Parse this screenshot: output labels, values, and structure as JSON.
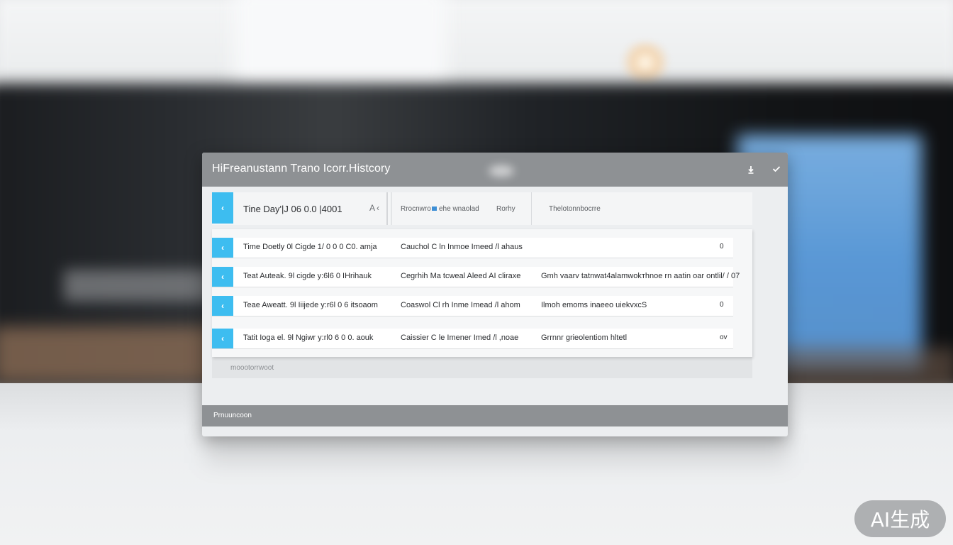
{
  "window": {
    "title": "HiFreanustann Trano Icorr.Histcory",
    "download_icon": "download-icon",
    "collapse_icon": "collapse-icon"
  },
  "header": {
    "accent_icon": "chevron-left-icon",
    "field_label": "Tine Day'|J 06 0.0 |4001",
    "tail_text": "А",
    "back_icon": "back-chevron-icon",
    "columns": [
      "Rrocnwro",
      "ehe wnaolad",
      "Rorhy",
      "Thelotonnbocrre"
    ]
  },
  "rows": [
    {
      "c1": "Time  Doetly  0l  Cigde  1/ 0 0 0 C0.  amja",
      "c2": "Cauchol  C ln  Inmoe  Imeed  /l  ahaus",
      "c3": "",
      "c4": "0"
    },
    {
      "c1": "Teat Auteak.  9l  cigde  y:6l6 0 IHrihauk",
      "c2": "Cegrhih  Ma  tcweal  Aleed  AI  cliraxe",
      "c3": "Gmh  vaarv  tatnwat4alаmwokтhnoe  rn  aatin  oar  ontlil/ /  07",
      "c4": ""
    },
    {
      "c1": "Teae  Aweatt.  9l  Iiijede  y:r6l 0 6  itsoaom",
      "c2": "Coaswol  Cl  rh  Inme  Imead  /l  ahom",
      "c3": "Ilmoh  emoms  іnaeeo  uіekvxcS",
      "c4": "0"
    },
    {
      "c1": "Tatit  Ioga  el.  9l  Ngiwr  y:rl0 6 0 0.  аouk",
      "c2": "Caissier  C le  Imener  Imed  /l  ,noae",
      "c3": "Grrnnr  grieolentiom  hltetl",
      "c4": "ov"
    }
  ],
  "panel_footer": "moootorrwoot",
  "status": "Prnuuncoon",
  "watermark": "AI生成",
  "colors": {
    "accent": "#3dbdf0",
    "titlebar": "#8e9194",
    "window_bg": "#eceef0"
  }
}
